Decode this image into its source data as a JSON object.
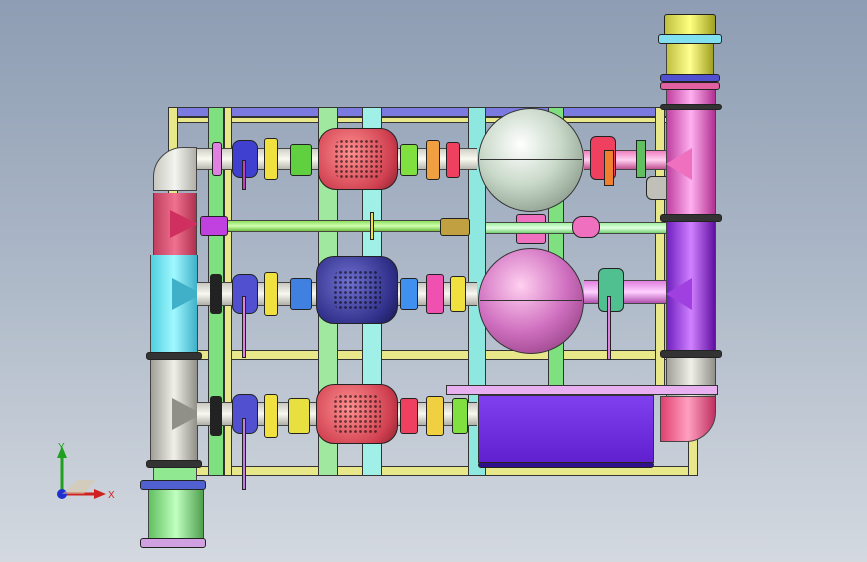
{
  "viewport": {
    "title": "",
    "background_top": "#8e9db3",
    "background_bottom": "#d4d9e0"
  },
  "model": {
    "description_visible": false,
    "colors": {
      "frame_yellow": "#e8e88a",
      "frame_green": "#7fe07f",
      "frame_cyan": "#8ee8e0",
      "pipe_magenta": "#e080e0",
      "pipe_pink": "#f070b0",
      "pipe_cyan": "#6ef0f0",
      "pipe_gray": "#c8c8c0",
      "pump_red": "#e06070",
      "pump_blue": "#3a3a9a",
      "tank_gray": "#c8d8c8",
      "tank_pink": "#d070c0",
      "tank_blue": "#8030e0",
      "yellow_fitting": "#f0e040",
      "green_fitting": "#80e040",
      "red_fitting": "#f04060"
    },
    "icons": {
      "pump_1": "pump-icon",
      "pump_2": "pump-icon",
      "pump_3": "pump-icon",
      "tank_1": "pressure-tank-icon",
      "tank_2": "pressure-tank-icon",
      "control_box": "control-box-icon"
    }
  },
  "triad": {
    "x_label": "X",
    "y_label": "Y",
    "x_color": "#d02020",
    "y_color": "#20a020",
    "z_color": "#2030d0"
  }
}
